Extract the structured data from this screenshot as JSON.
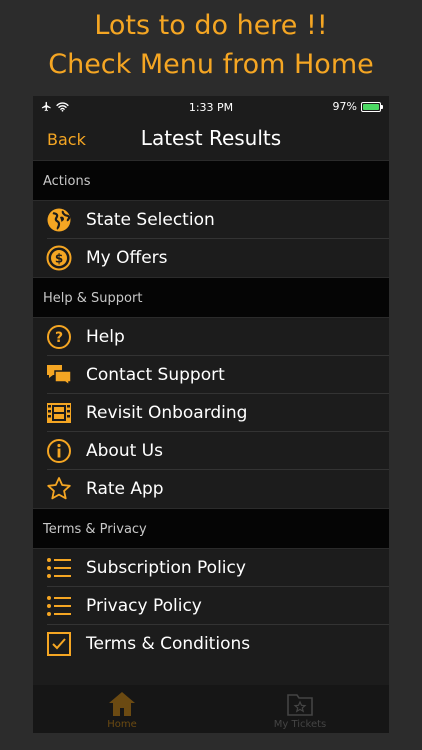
{
  "promo": {
    "line1": "Lots to do here !!",
    "line2": "Check Menu from Home"
  },
  "status_bar": {
    "time": "1:33 PM",
    "battery": "97%",
    "battery_level": 0.97
  },
  "nav": {
    "back_label": "Back",
    "title": "Latest Results"
  },
  "sections": [
    {
      "header": "Actions",
      "items": [
        {
          "label": "State Selection",
          "icon": "globe-icon"
        },
        {
          "label": "My Offers",
          "icon": "dollar-coin-icon"
        }
      ]
    },
    {
      "header": "Help & Support",
      "items": [
        {
          "label": "Help",
          "icon": "question-circle-icon"
        },
        {
          "label": "Contact Support",
          "icon": "chat-bubbles-icon"
        },
        {
          "label": "Revisit Onboarding",
          "icon": "film-strip-icon"
        },
        {
          "label": "About Us",
          "icon": "info-circle-icon"
        },
        {
          "label": "Rate App",
          "icon": "star-icon"
        }
      ]
    },
    {
      "header": "Terms & Privacy",
      "items": [
        {
          "label": "Subscription Policy",
          "icon": "list-icon"
        },
        {
          "label": "Privacy Policy",
          "icon": "list-icon"
        },
        {
          "label": "Terms & Conditions",
          "icon": "checkbox-icon"
        }
      ]
    }
  ],
  "tabbar": {
    "home_label": "Home",
    "tickets_label": "My Tickets"
  },
  "colors": {
    "accent": "#f5a623",
    "background": "#1c1c1c",
    "section_bg": "#050505"
  }
}
